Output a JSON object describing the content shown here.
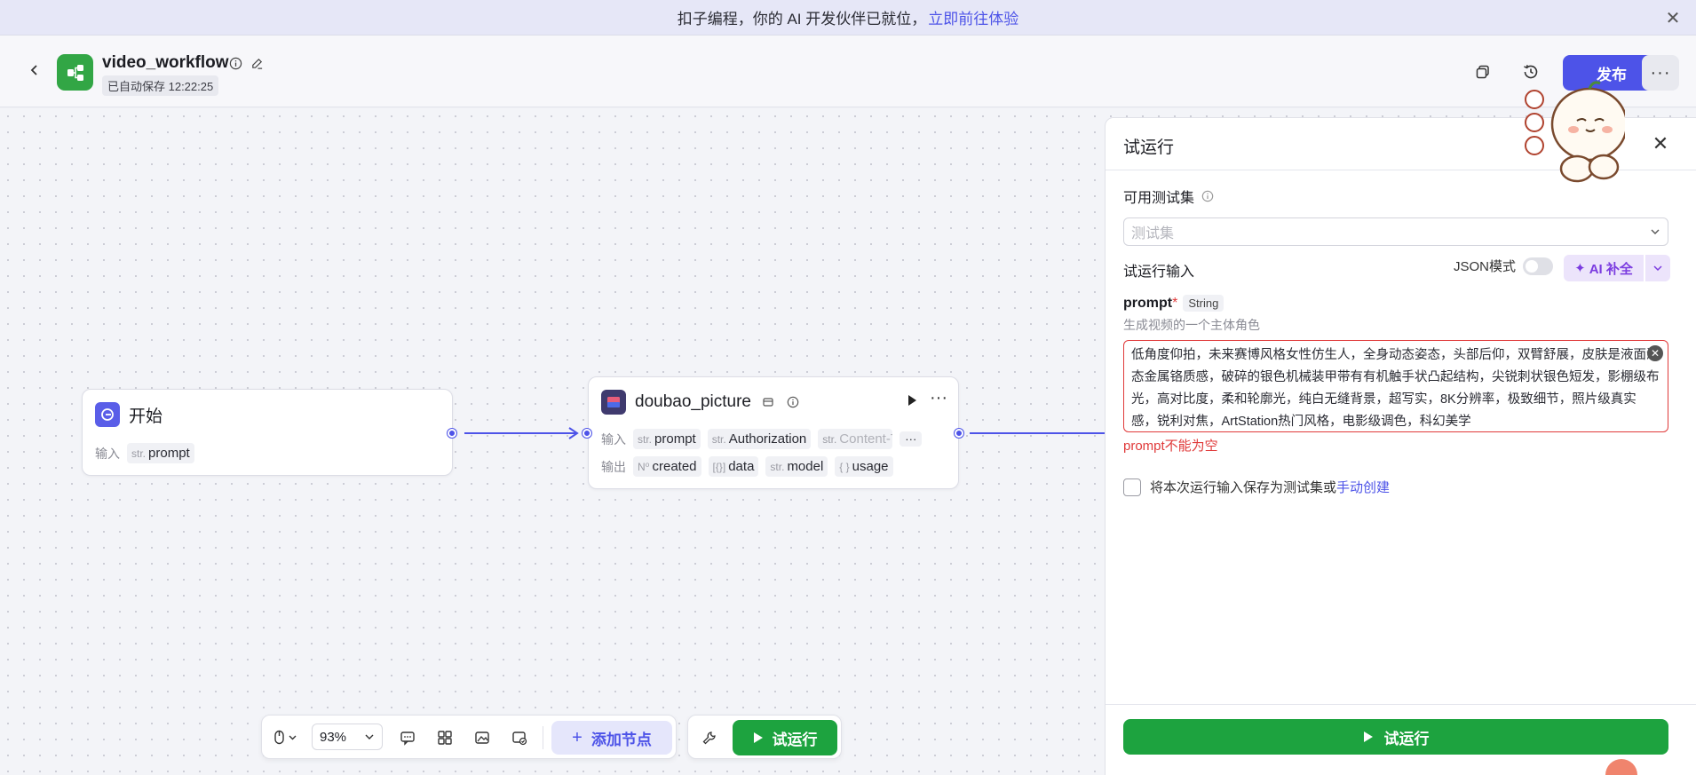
{
  "banner": {
    "text": "扣子编程，你的 AI 开发伙伴已就位，",
    "link": "立即前往体验"
  },
  "header": {
    "title": "video_workflow",
    "autosave": "已自动保存 12:22:25",
    "publish_label": "发布"
  },
  "nodes": {
    "start": {
      "title": "开始",
      "input_label": "输入",
      "inputs": [
        {
          "type": "str.",
          "name": "prompt"
        }
      ]
    },
    "doubao": {
      "title": "doubao_picture",
      "input_label": "输入",
      "output_label": "输出",
      "inputs": [
        {
          "type": "str.",
          "name": "prompt"
        },
        {
          "type": "str.",
          "name": "Authorization"
        },
        {
          "type": "str.",
          "name": "Content-T"
        }
      ],
      "outputs": [
        {
          "type": "N⁰",
          "name": "created"
        },
        {
          "type": "[{}]",
          "name": "data"
        },
        {
          "type": "str.",
          "name": "model"
        },
        {
          "type": "{ }",
          "name": "usage"
        }
      ],
      "more": "···"
    }
  },
  "toolbar": {
    "zoom": "93%",
    "add_node": "添加节点",
    "run": "试运行"
  },
  "panel": {
    "title": "试运行",
    "testset_label": "可用测试集",
    "testset_placeholder": "测试集",
    "input_label": "试运行输入",
    "json_mode": "JSON模式",
    "ai_fill": "AI 补全",
    "param_name": "prompt",
    "param_required": "*",
    "param_type": "String",
    "param_desc": "生成视频的一个主体角色",
    "param_value": "低角度仰拍，未来赛博风格女性仿生人，全身动态姿态，头部后仰，双臂舒展，皮肤是液面液态金属铬质感，破碎的银色机械装甲带有有机触手状凸起结构，尖锐刺状银色短发，影棚级布光，高对比度，柔和轮廓光，纯白无缝背景，超写实，8K分辨率，极致细节，照片级真实感，锐利对焦，ArtStation热门风格，电影级调色，科幻美学",
    "error": "prompt不能为空",
    "save_text": "将本次运行输入保存为测试集或",
    "save_link": "手动创建",
    "run_label": "试运行"
  },
  "colors": {
    "accent": "#4d53e8",
    "run_green": "#1da33f",
    "error": "#e03a3a"
  }
}
